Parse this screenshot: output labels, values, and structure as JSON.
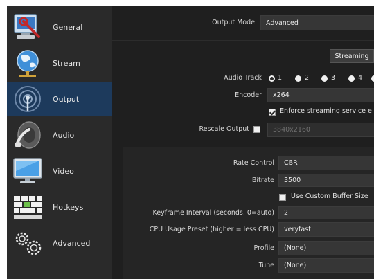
{
  "sidebar": {
    "items": [
      {
        "label": "General",
        "icon": "computer-wrench-icon"
      },
      {
        "label": "Stream",
        "icon": "globe-icon"
      },
      {
        "label": "Output",
        "icon": "broadcast-antenna-icon",
        "active": true
      },
      {
        "label": "Audio",
        "icon": "speaker-icon"
      },
      {
        "label": "Video",
        "icon": "monitor-icon"
      },
      {
        "label": "Hotkeys",
        "icon": "keyboard-icon"
      },
      {
        "label": "Advanced",
        "icon": "gears-icon"
      }
    ],
    "active_color": "#1d3a5c"
  },
  "output": {
    "mode_label": "Output Mode",
    "mode_value": "Advanced",
    "tabs": [
      "Streaming"
    ],
    "audio_track_label": "Audio Track",
    "audio_tracks": [
      "1",
      "2",
      "3",
      "4"
    ],
    "audio_track_selected": "1",
    "encoder_label": "Encoder",
    "encoder_value": "x264",
    "enforce_label": "Enforce streaming service e",
    "enforce_checked": true,
    "rescale_label": "Rescale Output",
    "rescale_checked": false,
    "rescale_value": "3840x2160",
    "rate_control_label": "Rate Control",
    "rate_control_value": "CBR",
    "bitrate_label": "Bitrate",
    "bitrate_value": "3500",
    "custom_buffer_label": "Use Custom Buffer Size",
    "custom_buffer_checked": false,
    "keyframe_label": "Keyframe Interval (seconds, 0=auto)",
    "keyframe_value": "2",
    "cpu_preset_label": "CPU Usage Preset (higher = less CPU)",
    "cpu_preset_value": "veryfast",
    "profile_label": "Profile",
    "profile_value": "(None)",
    "tune_label": "Tune",
    "tune_value": "(None)"
  }
}
